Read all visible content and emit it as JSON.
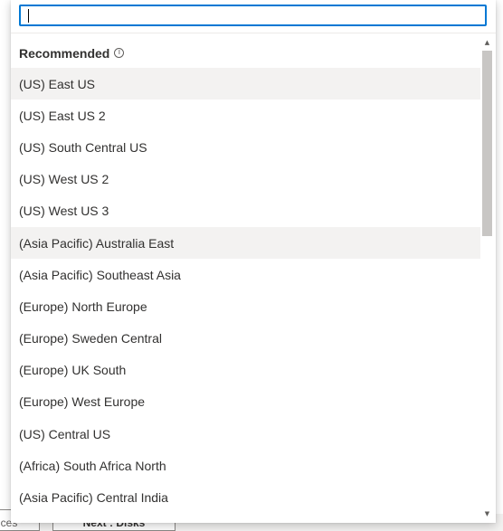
{
  "background": {
    "button_left_label": "vices",
    "button_right_label": "Next : Disks"
  },
  "search": {
    "value": "",
    "placeholder": ""
  },
  "group": {
    "label": "Recommended",
    "info_icon": "info-icon"
  },
  "options": [
    {
      "label": "(US) East US",
      "state": "selected"
    },
    {
      "label": "(US) East US 2",
      "state": ""
    },
    {
      "label": "(US) South Central US",
      "state": ""
    },
    {
      "label": "(US) West US 2",
      "state": ""
    },
    {
      "label": "(US) West US 3",
      "state": ""
    },
    {
      "label": "(Asia Pacific) Australia East",
      "state": "hovered"
    },
    {
      "label": "(Asia Pacific) Southeast Asia",
      "state": ""
    },
    {
      "label": "(Europe) North Europe",
      "state": ""
    },
    {
      "label": "(Europe) Sweden Central",
      "state": ""
    },
    {
      "label": "(Europe) UK South",
      "state": ""
    },
    {
      "label": "(Europe) West Europe",
      "state": ""
    },
    {
      "label": "(US) Central US",
      "state": ""
    },
    {
      "label": "(Africa) South Africa North",
      "state": ""
    },
    {
      "label": "(Asia Pacific) Central India",
      "state": ""
    }
  ],
  "colors": {
    "accent": "#0078d4",
    "selected_bg": "#f3f2f1",
    "text": "#323130",
    "scroll_thumb": "#c8c6c4"
  },
  "scroll": {
    "up_icon": "triangle-up-icon",
    "down_icon": "triangle-down-icon"
  }
}
